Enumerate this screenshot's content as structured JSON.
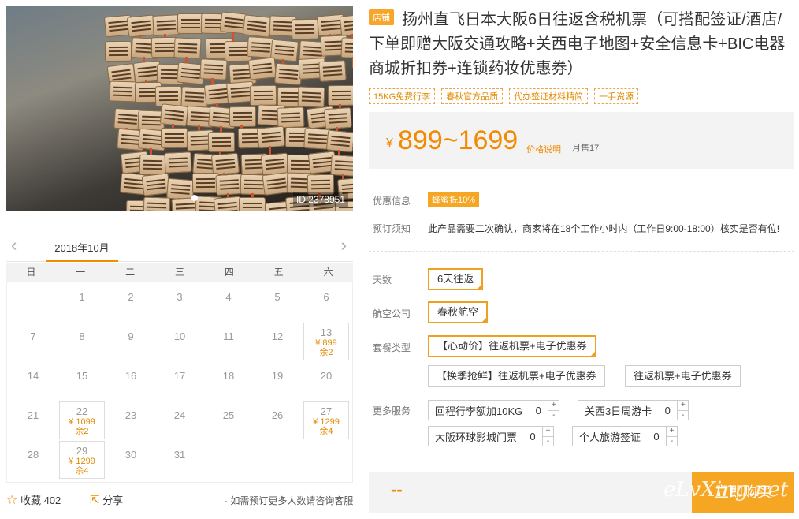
{
  "gallery": {
    "image_id": "ID:2378951"
  },
  "calendar": {
    "month": "2018年10月",
    "weekdays": [
      "日",
      "一",
      "二",
      "三",
      "四",
      "五",
      "六"
    ],
    "days": [
      "1",
      "2",
      "3",
      "4",
      "5",
      "6",
      "7",
      "8",
      "9",
      "10",
      "11",
      "12",
      "13",
      "14",
      "15",
      "16",
      "17",
      "18",
      "19",
      "20",
      "21",
      "22",
      "23",
      "24",
      "25",
      "26",
      "27",
      "28",
      "29",
      "30",
      "31"
    ],
    "available": {
      "d13": {
        "price": "¥ 899",
        "remain": "余2"
      },
      "d22": {
        "price": "¥ 1099",
        "remain": "余2"
      },
      "d27": {
        "price": "¥ 1299",
        "remain": "余4"
      },
      "d29": {
        "price": "¥ 1299",
        "remain": "余4"
      }
    }
  },
  "actions": {
    "favorite": "收藏 402",
    "share": "分享",
    "note": "· 如需预订更多人数请咨询客服"
  },
  "product": {
    "shop_tag": "店铺",
    "title": "扬州直飞日本大阪6日往返含税机票（可搭配签证/酒店/下单即赠大阪交通攻略+关西电子地图+安全信息卡+BIC电器商城折扣券+连锁药妆优惠券）",
    "features": [
      "15KG免费行李",
      "春秋官方品质",
      "代办签证材料精简",
      "一手资源"
    ],
    "currency": "¥",
    "price": "899~1699",
    "price_explain": "价格说明",
    "sold": "月售17"
  },
  "info": {
    "discount_label": "优惠信息",
    "discount": "蜂蜜抵10%",
    "notice_label": "预订须知",
    "notice": "此产品需要二次确认，商家将在18个工作小时内（工作日9:00-18:00）核实是否有位!"
  },
  "options": {
    "days_label": "天数",
    "days": "6天往返",
    "airline_label": "航空公司",
    "airline": "春秋航空",
    "package_label": "套餐类型",
    "packages": [
      "【心动价】往返机票+电子优惠券",
      "【换季抢鲜】往返机票+电子优惠券",
      "往返机票+电子优惠券"
    ],
    "more_label": "更多服务",
    "services": [
      {
        "name": "回程行李额加10KG",
        "qty": "0"
      },
      {
        "name": "关西3日周游卡",
        "qty": "0"
      },
      {
        "name": "大阪环球影城门票",
        "qty": "0"
      },
      {
        "name": "个人旅游签证",
        "qty": "0"
      }
    ],
    "plus": "+",
    "minus": "-"
  },
  "buy": {
    "placeholder": "--",
    "label": "立即购买",
    "watermark": "eLvXing.net"
  },
  "colors": {
    "accent": "#f28a00",
    "button": "#f5a623"
  }
}
